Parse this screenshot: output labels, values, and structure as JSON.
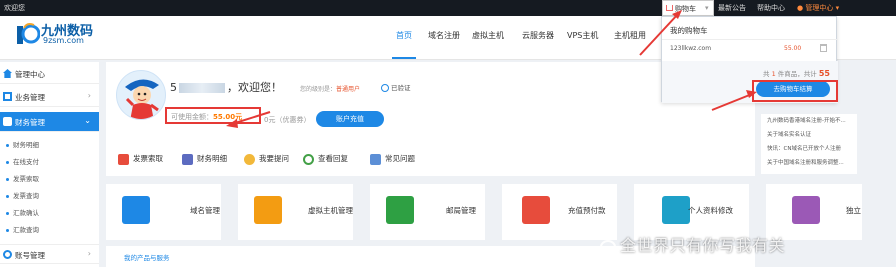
{
  "topbar": {
    "welcome": "欢迎您",
    "cart": "购物车",
    "announcement": "最新公告",
    "help": "帮助中心",
    "admin": "管理中心"
  },
  "logo": {
    "cn": "九州数码",
    "en": "9zsm.com"
  },
  "nav": [
    "首页",
    "域名注册",
    "虚拟主机",
    "云服务器",
    "VPS主机",
    "主机租用"
  ],
  "sidebar": {
    "items": [
      {
        "label": "管理中心"
      },
      {
        "label": "业务管理",
        "chevron": "›"
      },
      {
        "label": "财务管理",
        "chevron": "⌄"
      }
    ],
    "sub": [
      "财务明细",
      "在线支付",
      "发票索取",
      "发票查询",
      "汇款确认",
      "汇款查询"
    ],
    "bottom": {
      "label": "账号管理",
      "chevron": "›"
    }
  },
  "user": {
    "greeting_prefix": "5",
    "greeting": "，欢迎您！",
    "level_label": "您的级别是：",
    "level": "普通用户",
    "verified": "已验证",
    "balance_label": "可使用金额：",
    "balance_amount": "55.00元",
    "voucher": "0元（优惠券）",
    "recharge": "账户充值"
  },
  "quick_links": [
    "发票索取",
    "财务明细",
    "我要提问",
    "查看回复",
    "常见问题"
  ],
  "news": [
    "九州数码香港域名注册-开始不...",
    "关于域名实名认证",
    "快讯：CN域名已开放个人注册",
    "关于中国域名注册和服务调整..."
  ],
  "tiles": [
    "域名管理",
    "虚拟主机管理",
    "邮局管理",
    "充值预付款",
    "个人资料修改",
    "独立"
  ],
  "bottom_link": "我的产品与服务",
  "cart": {
    "title": "我的购物车",
    "product": "123llkwz.com",
    "price": "55.00",
    "summary_pre": "共",
    "count": "1",
    "summary_mid": "件商品，共计",
    "total": "55",
    "checkout": "去购物车结算"
  },
  "watermark": "全世界只有你写我有关",
  "colors": {
    "accent": "#1e88e5",
    "highlight": "#e53935",
    "topbar": "#151a21"
  }
}
